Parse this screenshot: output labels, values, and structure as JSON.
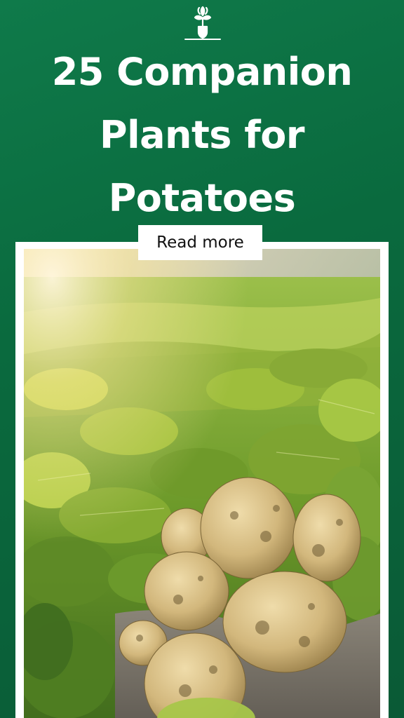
{
  "title_lines": [
    "25 Companion",
    "Plants for",
    "Potatoes"
  ],
  "cta_label": "Read more",
  "logo_icon": "shovel-sprout-icon",
  "photo_subject": "potato-harvest-photo",
  "colors": {
    "background_green": "#0a6a3e",
    "text_white": "#ffffff",
    "frame_white": "#ffffff"
  }
}
